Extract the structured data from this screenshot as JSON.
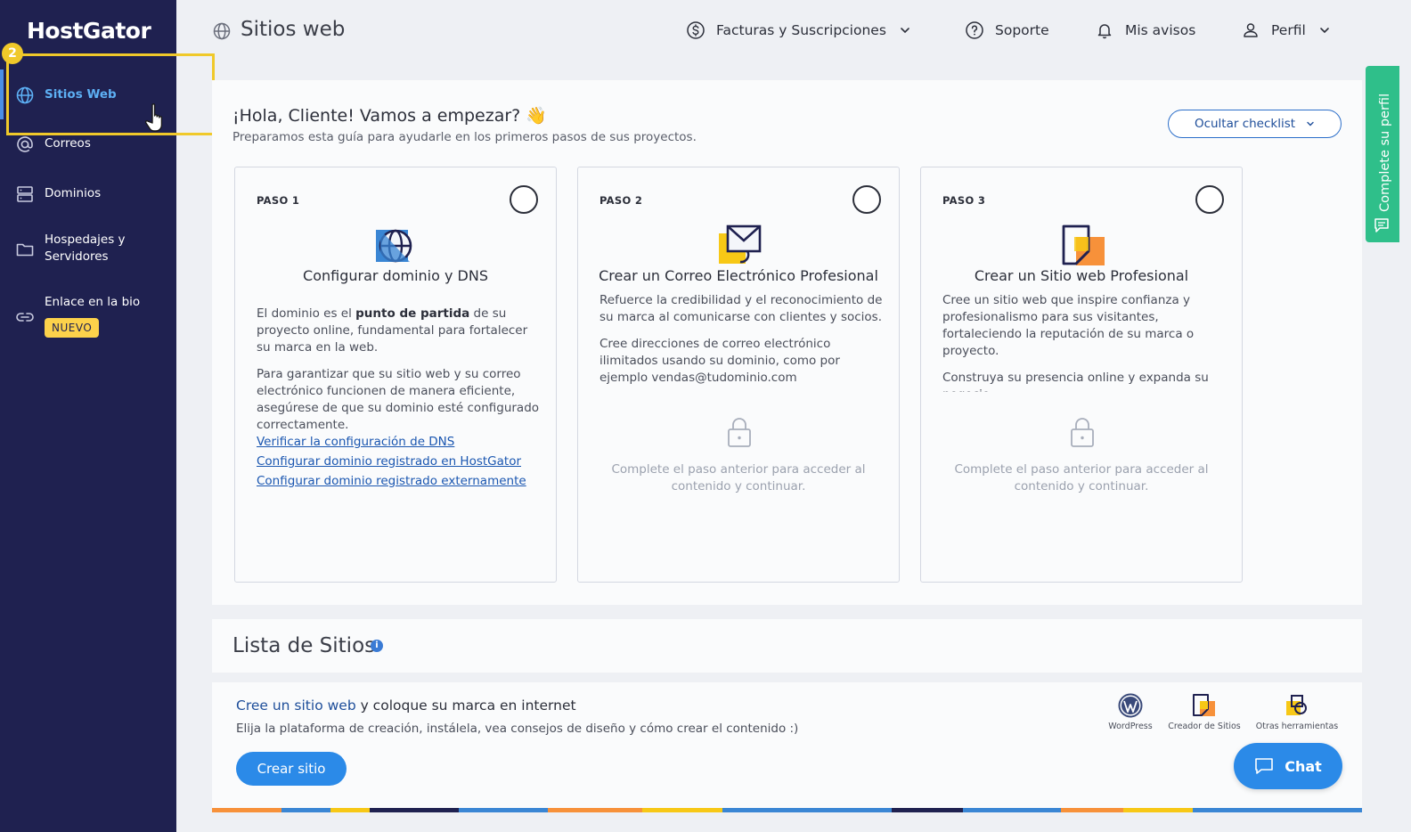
{
  "brand": {
    "logo": "HostGator"
  },
  "sidebar": {
    "items": [
      {
        "label": "Sitios Web",
        "icon": "globe-icon",
        "active": true
      },
      {
        "label": "Correos",
        "icon": "at-icon"
      },
      {
        "label": "Dominios",
        "icon": "server-icon"
      },
      {
        "label": "Hospedajes y Servidores",
        "icon": "folder-icon"
      },
      {
        "label": "Enlace en la bio",
        "icon": "link-icon",
        "badge": "NUEVO"
      }
    ],
    "step_marker": "2"
  },
  "header": {
    "title": "Sitios web",
    "billing": "Facturas y Suscripciones",
    "support": "Soporte",
    "notices": "Mis avisos",
    "profile": "Perfil"
  },
  "side_tab": {
    "label": "Complete su perfil"
  },
  "checklist": {
    "greeting": "¡Hola, Cliente! Vamos a empezar? 👋",
    "subtitle": "Preparamos esta guía para ayudarle en los primeros pasos de sus proyectos.",
    "hide_button": "Ocultar checklist",
    "locked_message": "Complete el paso anterior para acceder al contenido y continuar.",
    "steps": [
      {
        "step": "PASO 1",
        "title": "Configurar dominio y DNS",
        "p1_pre": "El dominio es el ",
        "p1_bold": "punto de partida",
        "p1_post": " de su proyecto online, fundamental para fortalecer su marca en la web.",
        "p2": "Para garantizar que su sitio web y su correo electrónico funcionen de manera eficiente, asegúrese de que su dominio esté configurado correctamente.",
        "links": [
          "Verificar la configuración de DNS",
          "Configurar dominio registrado en HostGator",
          "Configurar dominio registrado externamente"
        ]
      },
      {
        "step": "PASO 2",
        "title": "Crear un Correo Electrónico Profesional",
        "p1": "Refuerce la credibilidad y el reconocimiento de su marca al comunicarse con clientes y socios.",
        "p2": "Cree direcciones de correo electrónico ilimitados usando su dominio, como por ejemplo vendas@tudominio.com"
      },
      {
        "step": "PASO 3",
        "title": "Crear un Sitio web Profesional",
        "p1": "Cree un sitio web que inspire confianza y profesionalismo para sus visitantes, fortaleciendo la reputación de su marca o proyecto.",
        "p2": "Construya su presencia online y expanda su negocio."
      }
    ]
  },
  "site_list": {
    "title": "Lista de Sitios",
    "info": "i",
    "cta_highlight": "Cree un sitio web",
    "cta_rest": " y coloque su marca en internet",
    "cta_sub": "Elija la plataforma de creación, instálela, vea consejos de diseño y cómo crear el contenido :)",
    "create_button": "Crear sitio",
    "tools": [
      "WordPress",
      "Creador de Sitios",
      "Otras herramientas"
    ]
  },
  "chat": {
    "label": "Chat"
  },
  "colors": {
    "sidebar": "#1f2150",
    "accent": "#2b8ae8",
    "highlight": "#f0c92a",
    "profile_tab": "#2fbf8a"
  }
}
